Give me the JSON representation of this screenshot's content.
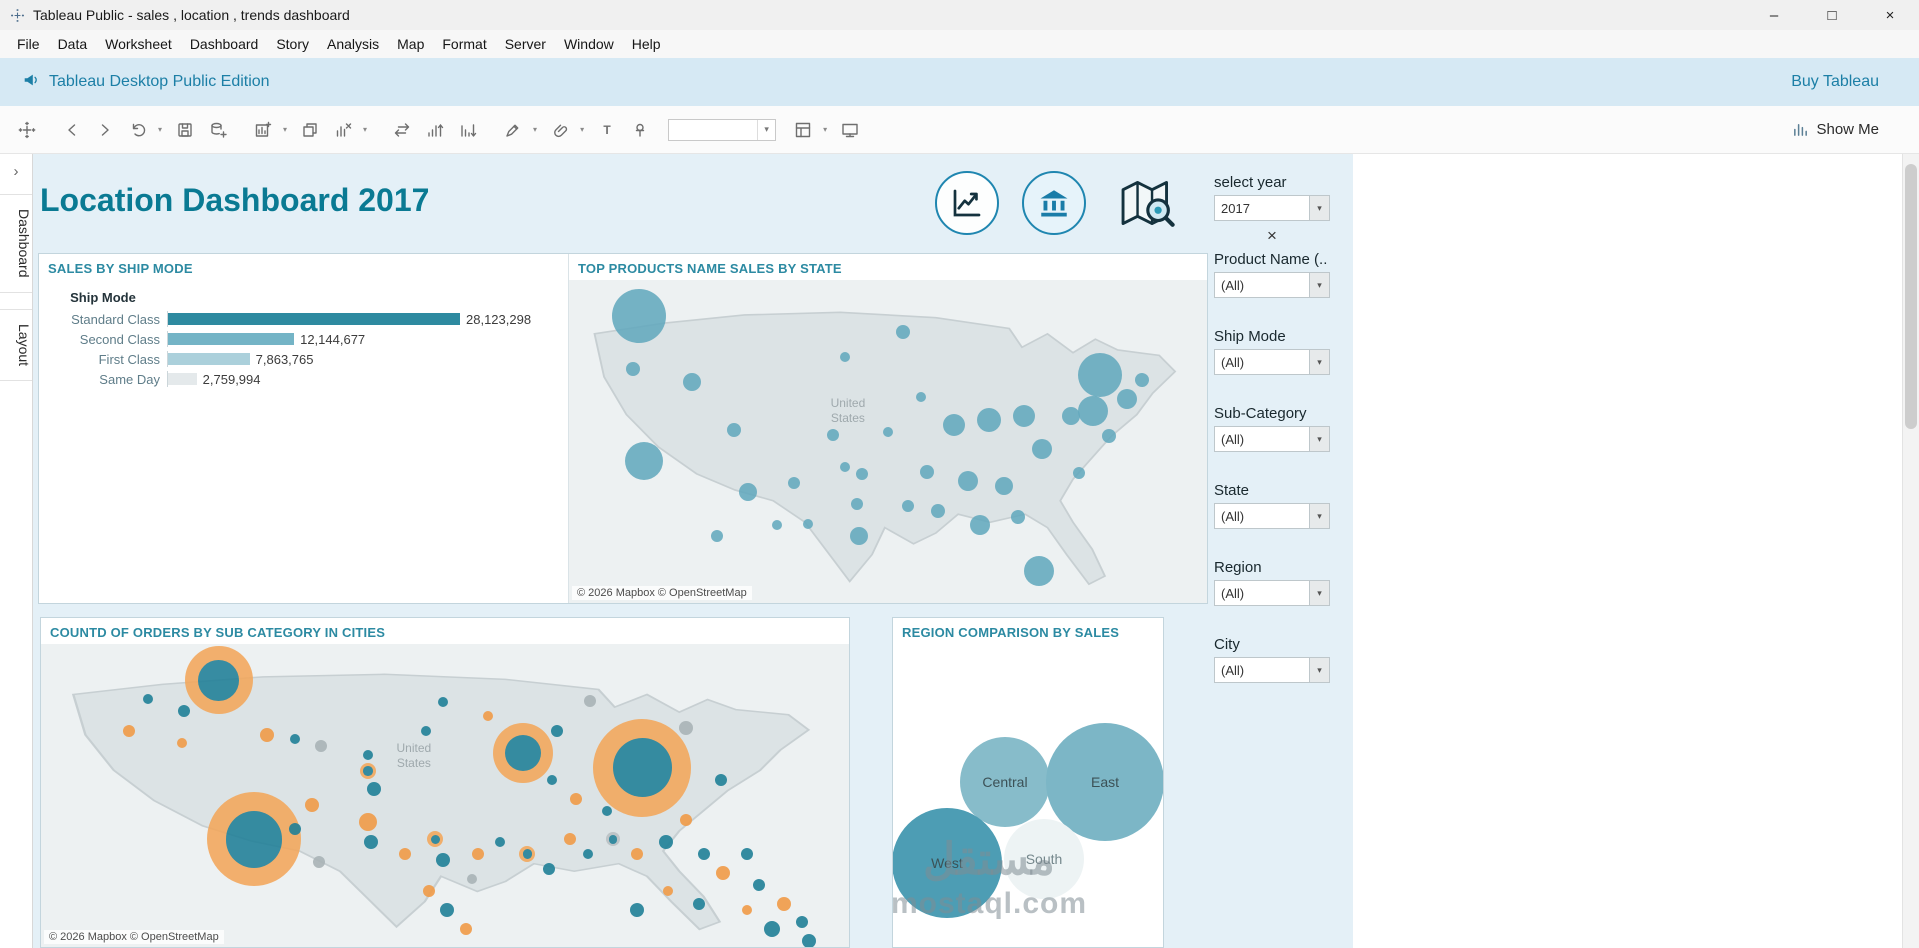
{
  "window": {
    "title": "Tableau Public - sales , location , trends dashboard"
  },
  "icons": {
    "minimize": "–",
    "maximize": "□",
    "close": "×",
    "dropdown_caret": "▾",
    "expand_pane": "›",
    "clear_filter": "×"
  },
  "menu": {
    "items": [
      "File",
      "Data",
      "Worksheet",
      "Dashboard",
      "Story",
      "Analysis",
      "Map",
      "Format",
      "Server",
      "Window",
      "Help"
    ]
  },
  "banner": {
    "edition_label": "Tableau Desktop Public Edition",
    "buy_label": "Buy Tableau"
  },
  "toolbar": {
    "show_me_label": "Show Me"
  },
  "side_tabs": {
    "items": [
      "Dashboard",
      "Layout"
    ]
  },
  "dashboard": {
    "title": "Location Dashboard 2017",
    "watermark": {
      "arabic": "مستقل",
      "latin": "mostaql.com"
    }
  },
  "filters": {
    "groups": [
      {
        "label": "select year",
        "value": "2017"
      },
      {
        "label": "Product Name (..",
        "value": "(All)"
      },
      {
        "label": "Ship Mode",
        "value": "(All)"
      },
      {
        "label": "Sub-Category",
        "value": "(All)"
      },
      {
        "label": "State",
        "value": "(All)"
      },
      {
        "label": "Region",
        "value": "(All)"
      },
      {
        "label": "City",
        "value": "(All)"
      }
    ]
  },
  "chart_data": [
    {
      "type": "bar",
      "title": "SALES BY SHIP MODE",
      "header": "Ship Mode",
      "categories": [
        "Standard Class",
        "Second Class",
        "First Class",
        "Same Day"
      ],
      "values": [
        28123298,
        12144677,
        7863765,
        2759994
      ],
      "value_labels": [
        "28,123,298",
        "12,144,677",
        "7,863,765",
        "2,759,994"
      ],
      "colors": [
        "#2e8aa0",
        "#74b4c6",
        "#abd0db",
        "#e4e9eb"
      ],
      "xlim": [
        0,
        28123298
      ]
    },
    {
      "type": "scatter",
      "title": "TOP PRODUCTS NAME  SALES BY STATE",
      "map_label": "United States",
      "attribution": "© 2026 Mapbox © OpenStreetMap",
      "bubble_color": "#63a8bd",
      "points": [
        [
          11,
          11,
          27
        ],
        [
          10,
          27.7,
          7
        ],
        [
          19.3,
          31.6,
          9
        ],
        [
          25.9,
          46.5,
          7
        ],
        [
          11.7,
          55.9,
          19
        ],
        [
          28,
          65.6,
          9
        ],
        [
          35.2,
          62.9,
          6
        ],
        [
          41.4,
          48,
          6
        ],
        [
          43.3,
          23.8,
          5
        ],
        [
          52.3,
          16,
          7
        ],
        [
          55.2,
          36.3,
          5
        ],
        [
          60.3,
          44.9,
          11
        ],
        [
          65.9,
          43.4,
          12
        ],
        [
          71.3,
          42.2,
          11
        ],
        [
          56.1,
          59.4,
          7
        ],
        [
          62.6,
          62.1,
          10
        ],
        [
          68.2,
          63.7,
          9
        ],
        [
          74.1,
          52.3,
          10
        ],
        [
          78.7,
          42.2,
          9
        ],
        [
          83.3,
          29.3,
          22
        ],
        [
          82.2,
          40.6,
          15
        ],
        [
          84.7,
          48.4,
          7
        ],
        [
          79.9,
          59.8,
          6
        ],
        [
          57.9,
          71.5,
          7
        ],
        [
          64.4,
          75.8,
          10
        ],
        [
          70.3,
          73.4,
          7
        ],
        [
          45.4,
          79.3,
          9
        ],
        [
          53.1,
          69.9,
          6
        ],
        [
          73.6,
          90.2,
          15
        ],
        [
          23.2,
          79.3,
          6
        ],
        [
          32.6,
          75.8,
          5
        ],
        [
          87.4,
          36.7,
          10
        ],
        [
          89.8,
          30.9,
          7
        ],
        [
          45.2,
          69.5,
          6
        ],
        [
          37.5,
          75.4,
          5
        ],
        [
          43.3,
          57.8,
          5
        ],
        [
          50,
          47,
          5
        ],
        [
          46,
          60,
          6
        ]
      ]
    },
    {
      "type": "scatter",
      "title": "COUNTD OF ORDERS BY SUB CATEGORY IN CITIES",
      "map_label": "United States",
      "attribution": "© 2026 Mapbox © OpenStreetMap",
      "colors": {
        "teal": "#1f7f97",
        "orange": "#ef9a47",
        "gray": "#a9b2b6",
        "ring_orange": "#f3a75b",
        "ring_gray": "#b9c0c3"
      },
      "points": [
        [
          22,
          12,
          34,
          "ro"
        ],
        [
          17.7,
          22,
          6,
          "t"
        ],
        [
          13.2,
          18,
          5,
          "t"
        ],
        [
          10.9,
          28.6,
          6,
          "o"
        ],
        [
          17.4,
          32.7,
          5,
          "o"
        ],
        [
          28,
          30,
          7,
          "o"
        ],
        [
          31.4,
          31.4,
          5,
          "t"
        ],
        [
          34.7,
          33.5,
          6,
          "g"
        ],
        [
          40.5,
          42,
          8,
          "ro"
        ],
        [
          41.2,
          48,
          7,
          "t"
        ],
        [
          40.5,
          36.7,
          5,
          "t"
        ],
        [
          47.6,
          28.6,
          5,
          "t"
        ],
        [
          49.8,
          19.2,
          5,
          "t"
        ],
        [
          55.3,
          23.7,
          5,
          "o"
        ],
        [
          59.7,
          36,
          30,
          "ro"
        ],
        [
          63.9,
          28.6,
          6,
          "t"
        ],
        [
          68,
          18.8,
          6,
          "g"
        ],
        [
          74.4,
          40.8,
          49,
          "ro"
        ],
        [
          79.8,
          27.8,
          7,
          "g"
        ],
        [
          84.1,
          44.9,
          6,
          "t"
        ],
        [
          26.4,
          64.5,
          47,
          "ro"
        ],
        [
          33.6,
          53.1,
          7,
          "o"
        ],
        [
          31.4,
          61.2,
          6,
          "t"
        ],
        [
          40.5,
          58.8,
          9,
          "o"
        ],
        [
          40.8,
          65.3,
          7,
          "t"
        ],
        [
          45,
          69.4,
          6,
          "o"
        ],
        [
          48.8,
          64.5,
          8,
          "ro"
        ],
        [
          49.8,
          71.4,
          7,
          "t"
        ],
        [
          54.1,
          69.4,
          6,
          "o"
        ],
        [
          56.8,
          65.3,
          5,
          "t"
        ],
        [
          60.2,
          69.4,
          8,
          "ro"
        ],
        [
          62.9,
          74.3,
          6,
          "t"
        ],
        [
          65.5,
          64.5,
          6,
          "o"
        ],
        [
          67.7,
          69.4,
          5,
          "t"
        ],
        [
          70.8,
          64.5,
          7,
          "rg"
        ],
        [
          73.8,
          69.4,
          6,
          "o"
        ],
        [
          77.3,
          65.3,
          7,
          "t"
        ],
        [
          79.8,
          58,
          6,
          "o"
        ],
        [
          82.1,
          69.4,
          6,
          "t"
        ],
        [
          84.4,
          75.5,
          7,
          "o"
        ],
        [
          87.4,
          69.4,
          6,
          "t"
        ],
        [
          88.9,
          79.6,
          6,
          "t"
        ],
        [
          92,
          85.7,
          7,
          "o"
        ],
        [
          94.2,
          91.8,
          6,
          "t"
        ],
        [
          90.5,
          93.9,
          8,
          "t"
        ],
        [
          87.4,
          87.8,
          5,
          "o"
        ],
        [
          81.4,
          85.7,
          6,
          "t"
        ],
        [
          77.6,
          81.6,
          5,
          "o"
        ],
        [
          73.8,
          87.8,
          7,
          "t"
        ],
        [
          48,
          81.6,
          6,
          "o"
        ],
        [
          50.3,
          87.8,
          7,
          "t"
        ],
        [
          52.6,
          93.9,
          6,
          "o"
        ],
        [
          34.4,
          71.8,
          6,
          "g"
        ],
        [
          53.3,
          77.6,
          5,
          "g"
        ],
        [
          63.2,
          44.9,
          5,
          "t"
        ],
        [
          66.2,
          51,
          6,
          "o"
        ],
        [
          70,
          55.1,
          5,
          "t"
        ],
        [
          95,
          98,
          7,
          "t"
        ]
      ]
    },
    {
      "type": "pie",
      "title": "REGION COMPARISON BY SALES",
      "bubbles": [
        {
          "label": "Central",
          "x": 112,
          "y": 138,
          "r": 45,
          "color": "#87bcca",
          "text_color": "#3c5156"
        },
        {
          "label": "East",
          "x": 212,
          "y": 138,
          "r": 59,
          "color": "#7cb6c6",
          "text_color": "#3c5156"
        },
        {
          "label": "West",
          "x": 54,
          "y": 219,
          "r": 55,
          "color": "#4d9db4",
          "text_color": "#3c5156"
        },
        {
          "label": "South",
          "x": 151,
          "y": 215,
          "r": 40,
          "color": "#edf3f4",
          "text_color": "#75878c"
        }
      ]
    }
  ]
}
